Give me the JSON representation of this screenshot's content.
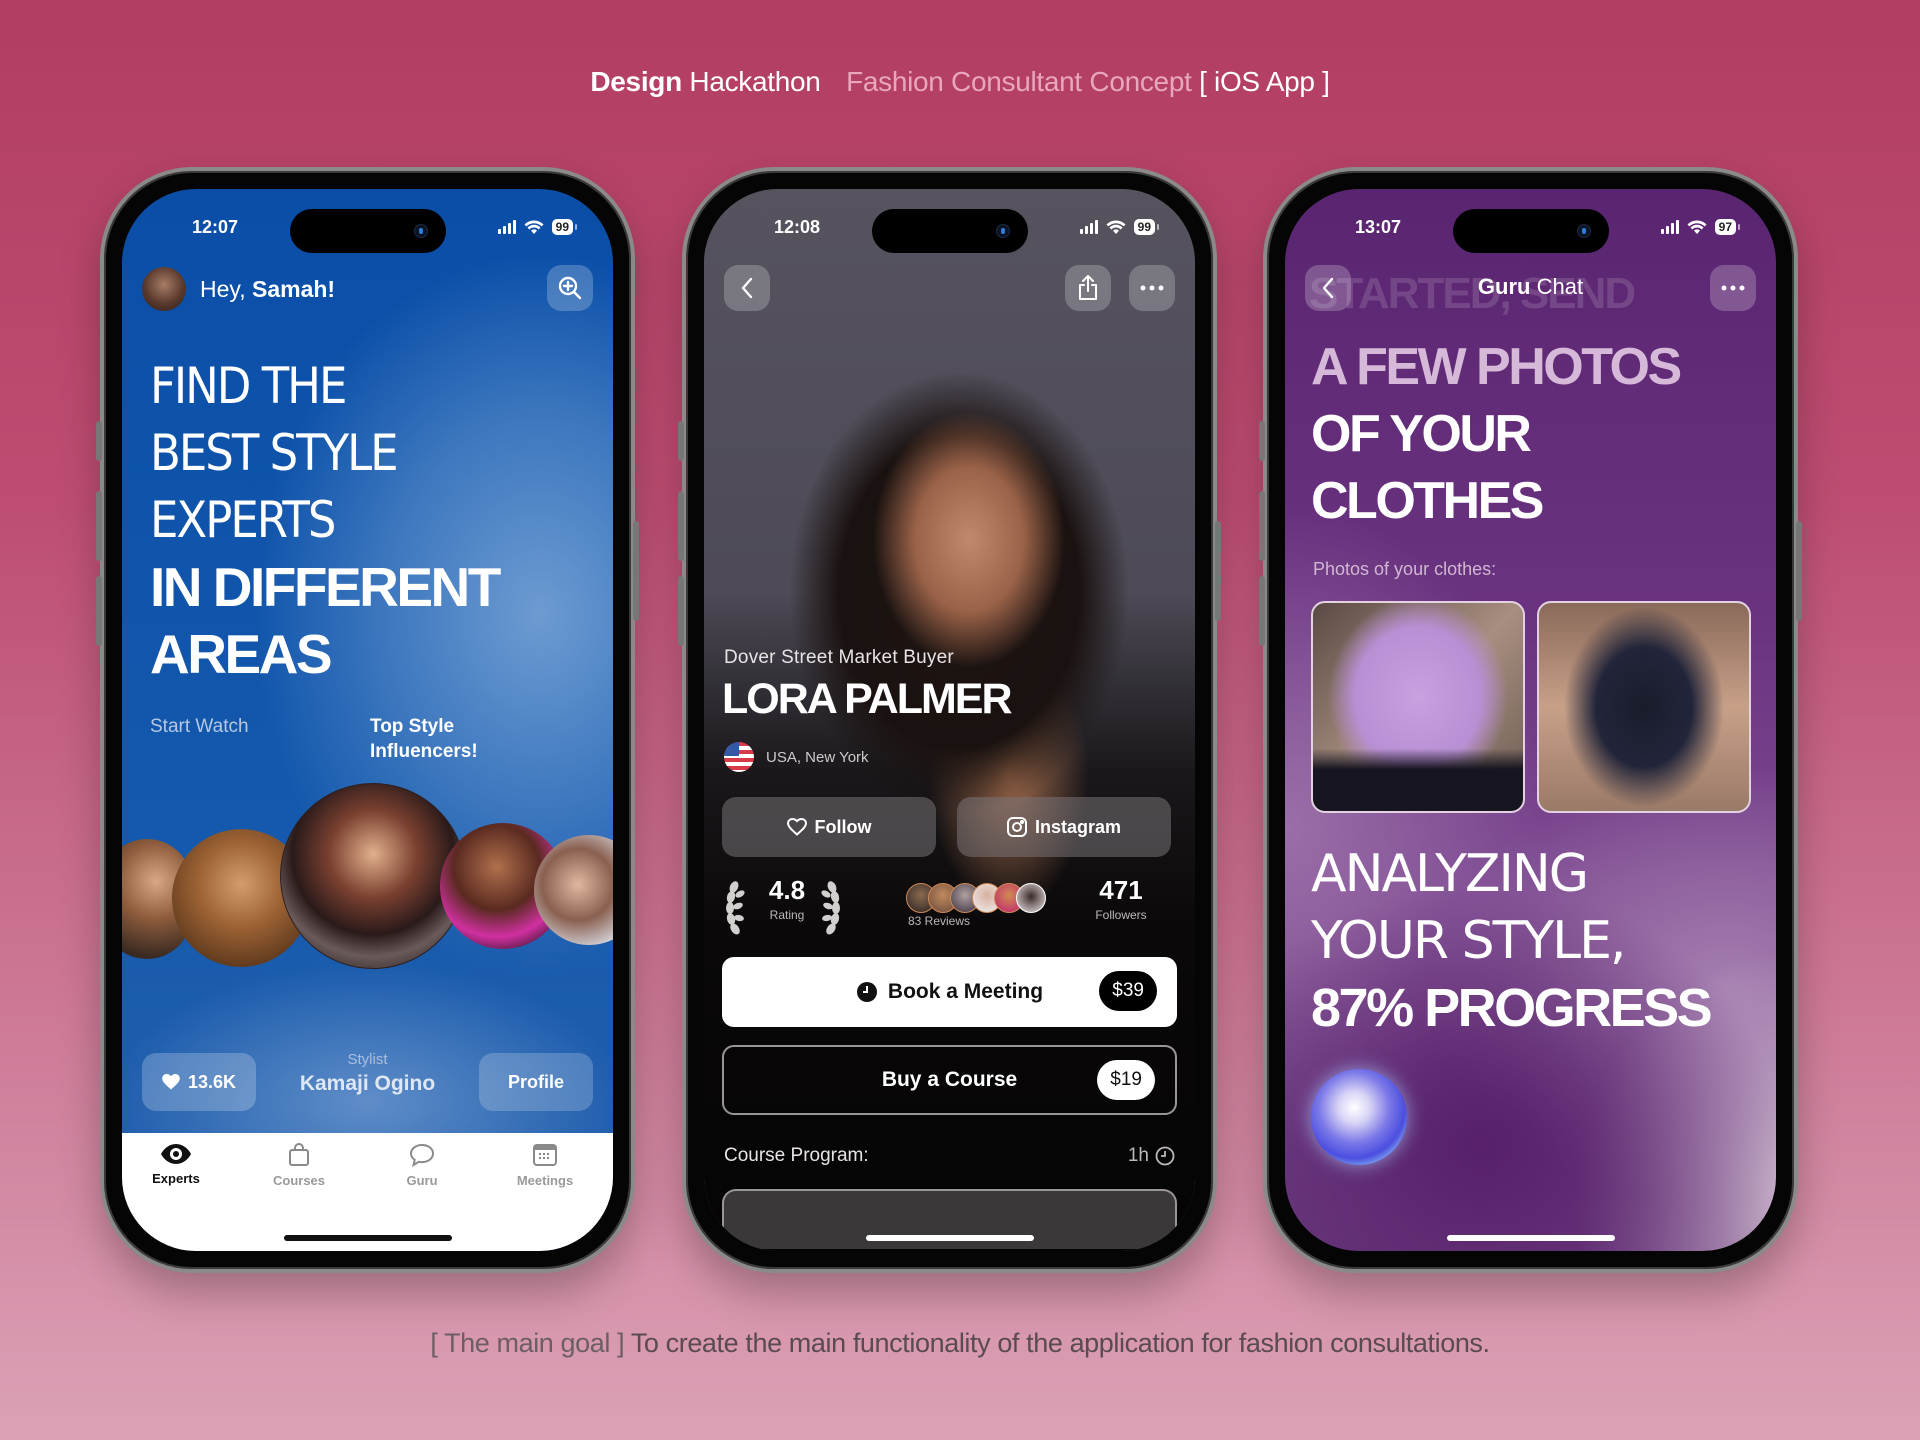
{
  "header": {
    "brand_bold": "Design",
    "brand_light": "Hackathon",
    "project": "Fashion Consultant Concept",
    "platform": "[ iOS App ]"
  },
  "footer": {
    "prefix": "[ The main goal ]",
    "text": "To create the main functionality of the application for fashion consultations."
  },
  "phone_experts": {
    "status": {
      "time": "12:07",
      "battery": "99"
    },
    "greeting": {
      "hey": "Hey,",
      "name": "Samah!"
    },
    "search_icon": "zoom-in-icon",
    "hero": {
      "light_lines": [
        "FIND THE",
        "BEST STYLE",
        "EXPERTS"
      ],
      "bold_lines": [
        "IN DIFFERENT",
        "AREAS"
      ]
    },
    "start_watch": "Start Watch",
    "top_style": "Top Style\nInfluencers!",
    "featured": {
      "likes": "13.6K",
      "role": "Stylist",
      "name": "Kamaji Ogino",
      "profile_button": "Profile"
    },
    "tabs": [
      {
        "label": "Experts",
        "icon": "eye-icon",
        "active": true
      },
      {
        "label": "Courses",
        "icon": "bag-icon",
        "active": false
      },
      {
        "label": "Guru",
        "icon": "chat-bubble-icon",
        "active": false
      },
      {
        "label": "Meetings",
        "icon": "calendar-icon",
        "active": false
      }
    ]
  },
  "phone_profile": {
    "status": {
      "time": "12:08",
      "battery": "99"
    },
    "title": "Dover Street Market Buyer",
    "name": "LORA PALMER",
    "location": "USA, New York",
    "follow_button": "Follow",
    "instagram_button": "Instagram",
    "rating": {
      "value": "4.8",
      "label": "Rating"
    },
    "reviews": {
      "label": "83 Reviews"
    },
    "followers": {
      "value": "471",
      "label": "Followers"
    },
    "book_meeting": {
      "label": "Book a Meeting",
      "price": "$39"
    },
    "buy_course": {
      "label": "Buy a Course",
      "price": "$19"
    },
    "course_program": {
      "label": "Course Program:",
      "duration": "1h"
    }
  },
  "phone_guru": {
    "status": {
      "time": "13:07",
      "battery": "97"
    },
    "title_bold": "Guru",
    "title_light": "Chat",
    "ghost_text": "STARTED, SEND",
    "heading": {
      "faded": "A FEW PHOTOS",
      "lines": [
        "OF YOUR",
        "CLOTHES"
      ]
    },
    "photos_label": "Photos of your clothes:",
    "analyzing": {
      "lines": [
        "ANALYZING",
        "YOUR STYLE,"
      ],
      "progress_text": "87% PROGRESS",
      "progress_percent": 87
    }
  }
}
